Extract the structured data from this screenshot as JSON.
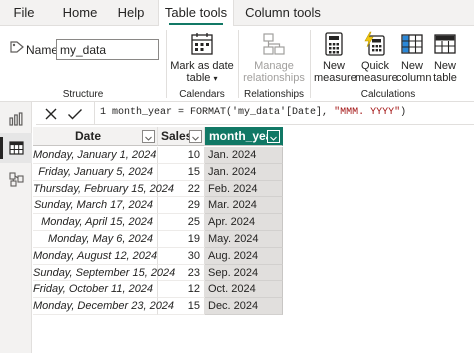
{
  "tabs": [
    {
      "label": "File",
      "active": false
    },
    {
      "label": "Home",
      "active": false
    },
    {
      "label": "Help",
      "active": false
    },
    {
      "label": "Table tools",
      "active": true
    },
    {
      "label": "Column tools",
      "active": false
    }
  ],
  "ribbon": {
    "name_label": "Name",
    "name_value": "my_data",
    "mark_date_line1": "Mark as date",
    "mark_date_line2": "table",
    "manage_line1": "Manage",
    "manage_line2": "relationships",
    "new_measure_line1": "New",
    "new_measure_line2": "measure",
    "quick_measure_line1": "Quick",
    "quick_measure_line2": "measure",
    "new_column_line1": "New",
    "new_column_line2": "column",
    "new_table_line1": "New",
    "new_table_line2": "table",
    "groups": {
      "structure": "Structure",
      "calendars": "Calendars",
      "relationships": "Relationships",
      "calculations": "Calculations"
    }
  },
  "formula": {
    "line_number": "1",
    "text_before": "month_year = FORMAT('my_data'[Date], ",
    "string_arg": "\"MMM. YYYY\"",
    "text_after": ")"
  },
  "table": {
    "headers": {
      "date": "Date",
      "sales": "Sales",
      "month_year": "month_year"
    },
    "rows": [
      {
        "date": "Monday, January 1, 2024",
        "sales": "10",
        "month_year": "Jan. 2024"
      },
      {
        "date": "Friday, January 5, 2024",
        "sales": "15",
        "month_year": "Jan. 2024"
      },
      {
        "date": "Thursday, February 15, 2024",
        "sales": "22",
        "month_year": "Feb. 2024"
      },
      {
        "date": "Sunday, March 17, 2024",
        "sales": "29",
        "month_year": "Mar. 2024"
      },
      {
        "date": "Monday, April 15, 2024",
        "sales": "25",
        "month_year": "Apr. 2024"
      },
      {
        "date": "Monday, May 6, 2024",
        "sales": "19",
        "month_year": "May. 2024"
      },
      {
        "date": "Monday, August 12, 2024",
        "sales": "30",
        "month_year": "Aug. 2024"
      },
      {
        "date": "Sunday, September 15, 2024",
        "sales": "23",
        "month_year": "Sep. 2024"
      },
      {
        "date": "Friday, October 11, 2024",
        "sales": "12",
        "month_year": "Oct. 2024"
      },
      {
        "date": "Monday, December 23, 2024",
        "sales": "15",
        "month_year": "Dec. 2024"
      }
    ]
  },
  "icons": {
    "name": "tag-icon",
    "mark_date": "calendar-table-icon",
    "manage": "relationships-icon",
    "new_measure": "calculator-icon",
    "quick_measure": "lightning-calculator-icon",
    "new_column": "column-table-icon",
    "new_table": "table-icon",
    "rail": [
      "report-view-icon",
      "table-view-icon",
      "model-view-icon"
    ],
    "cancel": "x-icon",
    "commit": "check-icon"
  },
  "colors": {
    "accent": "#117865",
    "selected_column": "#e1dfdd"
  }
}
